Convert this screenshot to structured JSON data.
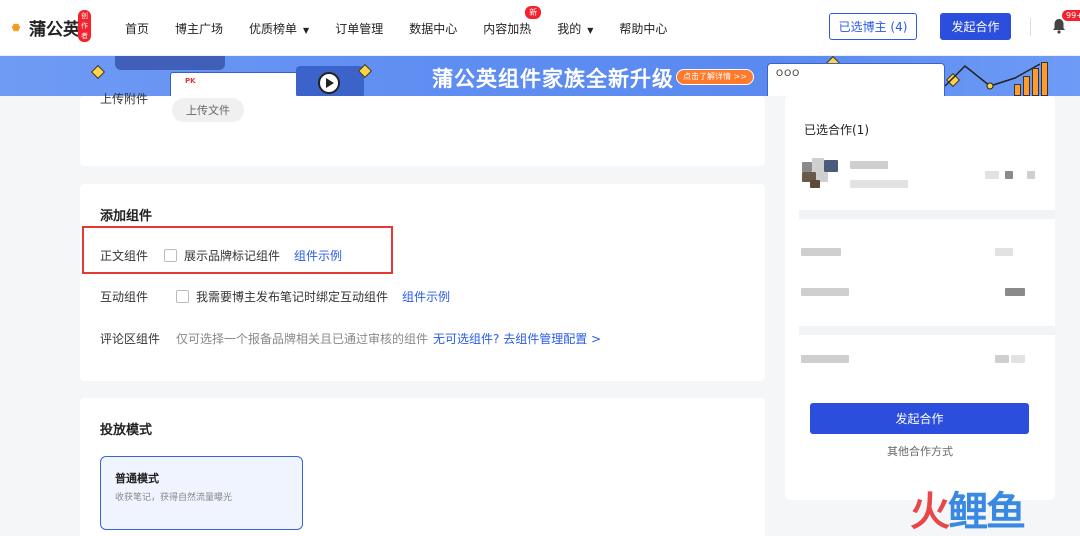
{
  "app": {
    "logo_text": "蒲公英",
    "logo_badge": "创作者"
  },
  "nav": {
    "items": [
      {
        "label": "首页",
        "caret": false,
        "badge": ""
      },
      {
        "label": "博主广场",
        "caret": false,
        "badge": ""
      },
      {
        "label": "优质榜单",
        "caret": true,
        "badge": ""
      },
      {
        "label": "订单管理",
        "caret": false,
        "badge": ""
      },
      {
        "label": "数据中心",
        "caret": false,
        "badge": ""
      },
      {
        "label": "内容加热",
        "caret": false,
        "badge": "新"
      },
      {
        "label": "我的",
        "caret": true,
        "badge": ""
      },
      {
        "label": "帮助中心",
        "caret": false,
        "badge": ""
      }
    ],
    "selected_btn": "已选博主 (4)",
    "start_btn": "发起合作",
    "notification_count": "99+"
  },
  "banner": {
    "title": "蒲公英组件家族全新升级",
    "cta": "点击了解详情 >>",
    "card_tag": "PK",
    "window_dots": "OOO"
  },
  "upload": {
    "label": "上传附件",
    "button": "上传文件"
  },
  "components": {
    "title": "添加组件",
    "body_label": "正文组件",
    "body_option": "展示品牌标记组件",
    "body_link": "组件示例",
    "interact_label": "互动组件",
    "interact_option": "我需要博主发布笔记时绑定互动组件",
    "interact_link": "组件示例",
    "comment_label": "评论区组件",
    "comment_desc": "仅可选择一个报备品牌相关且已通过审核的组件",
    "comment_link": "无可选组件? 去组件管理配置 >"
  },
  "delivery": {
    "title": "投放模式",
    "mode_title": "普通模式",
    "mode_desc": "收获笔记，获得自然流量曝光"
  },
  "right_panel": {
    "title": "已选合作(1)",
    "start_btn": "发起合作",
    "other": "其他合作方式"
  },
  "watermark": {
    "part1": "火",
    "part2": "鲤鱼"
  },
  "colors": {
    "primary": "#2b4fdc",
    "link": "#2a5be8",
    "highlight": "#e53935",
    "badge": "#f5222d"
  }
}
